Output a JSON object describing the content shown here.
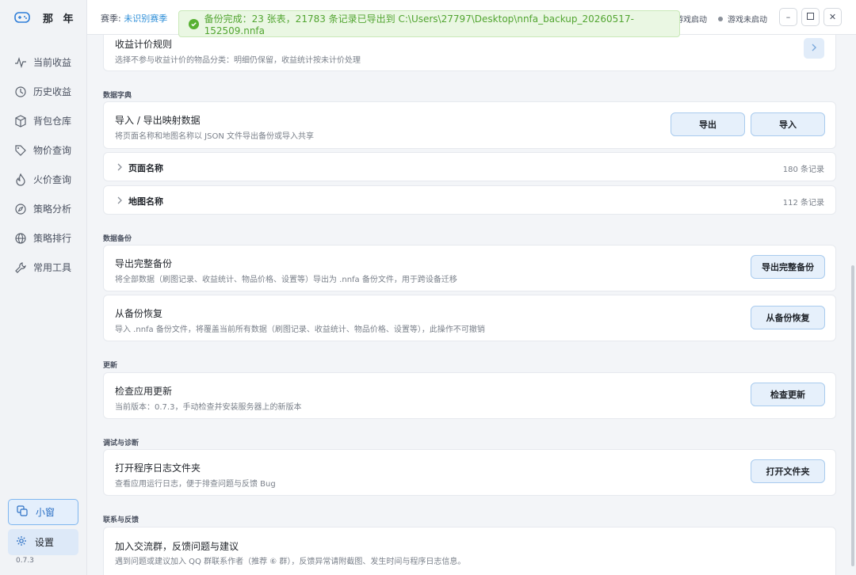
{
  "app": {
    "name": "那 年",
    "version": "0.7.3"
  },
  "sidebar": {
    "items": [
      {
        "label": "当前收益",
        "icon": "pulse-icon"
      },
      {
        "label": "历史收益",
        "icon": "history-icon"
      },
      {
        "label": "背包仓库",
        "icon": "box-icon"
      },
      {
        "label": "物价查询",
        "icon": "tag-icon"
      },
      {
        "label": "火价查询",
        "icon": "flame-icon"
      },
      {
        "label": "策略分析",
        "icon": "compass-icon"
      },
      {
        "label": "策略排行",
        "icon": "globe-icon"
      },
      {
        "label": "常用工具",
        "icon": "wrench-icon"
      }
    ],
    "mini_window": "小窗",
    "settings": "设置"
  },
  "topbar": {
    "season_label": "赛季:",
    "season_value": "未识别赛季",
    "game_status_1": "游戏启动",
    "game_status_2": "游戏未启动"
  },
  "toast": {
    "text": "备份完成：23 张表，21783 条记录已导出到 C:\\Users\\27797\\Desktop\\nnfa_backup_20260517-152509.nnfa"
  },
  "sections": {
    "income_rule": {
      "title": "收益计价规则",
      "desc": "选择不参与收益计价的物品分类：明细仍保留，收益统计按未计价处理"
    },
    "dictionary": {
      "label": "数据字典",
      "io_title": "导入 / 导出映射数据",
      "io_desc": "将页面名称和地图名称以 JSON 文件导出备份或导入共享",
      "export_btn": "导出",
      "import_btn": "导入",
      "rows": [
        {
          "label": "页面名称",
          "count": "180 条记录"
        },
        {
          "label": "地图名称",
          "count": "112 条记录"
        }
      ]
    },
    "backup": {
      "label": "数据备份",
      "export_title": "导出完整备份",
      "export_desc": "将全部数据（刷图记录、收益统计、物品价格、设置等）导出为 .nnfa 备份文件，用于跨设备迁移",
      "export_btn": "导出完整备份",
      "restore_title": "从备份恢复",
      "restore_desc": "导入 .nnfa 备份文件，将覆盖当前所有数据（刷图记录、收益统计、物品价格、设置等），此操作不可撤销",
      "restore_btn": "从备份恢复"
    },
    "update": {
      "label": "更新",
      "title": "检查应用更新",
      "desc": "当前版本：0.7.3，手动检查并安装服务器上的新版本",
      "btn": "检查更新"
    },
    "debug": {
      "label": "调试与诊断",
      "title": "打开程序日志文件夹",
      "desc": "查看应用运行日志，便于排查问题与反馈 Bug",
      "btn": "打开文件夹"
    },
    "contact": {
      "label": "联系与反馈",
      "title": "加入交流群，反馈问题与建议",
      "desc": "遇到问题或建议加入 QQ 群联系作者（推荐 ⑥ 群），反馈异常请附截图、发生时间与程序日志信息。"
    }
  }
}
